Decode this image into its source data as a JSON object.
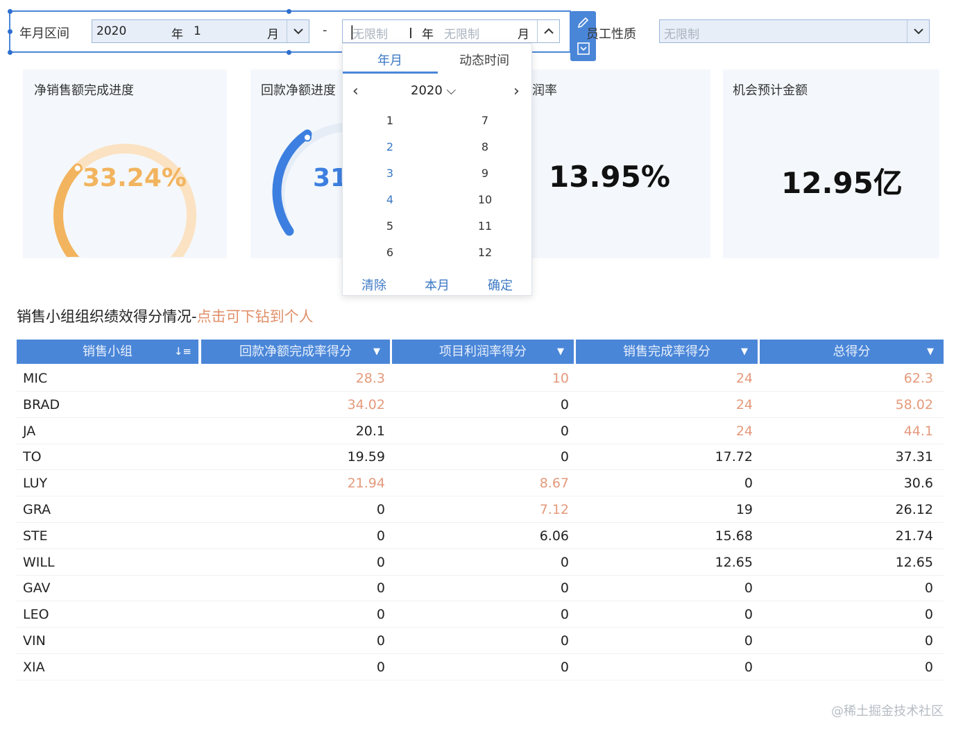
{
  "filter": {
    "range_label": "年月区间",
    "from_year": "2020",
    "year_unit": "年",
    "from_month": "1",
    "month_unit": "月",
    "separator": "-",
    "to_year_placeholder": "无限制",
    "to_month_placeholder": "无限制",
    "staff_label": "员工性质",
    "staff_placeholder": "无限制"
  },
  "kpis": {
    "sales_title": "净销售额完成进度",
    "sales_value": "33.24%",
    "sales_fraction": 0.3324,
    "refund_title": "回款净额进度",
    "refund_value_partial": "31",
    "profit_title_partial": "润率",
    "profit_value": "13.95%",
    "opportunity_title": "机会预计金额",
    "opportunity_value": "12.95亿"
  },
  "picker": {
    "tab_year_month": "年月",
    "tab_dynamic": "动态时间",
    "year": "2020",
    "months_left": [
      "1",
      "2",
      "3",
      "4",
      "5",
      "6"
    ],
    "months_right": [
      "7",
      "8",
      "9",
      "10",
      "11",
      "12"
    ],
    "btn_clear": "清除",
    "btn_this_month": "本月",
    "btn_confirm": "确定"
  },
  "table": {
    "title": "销售小组组织绩效得分情况-",
    "title_drill": "点击可下钻到个人",
    "headers": [
      "销售小组",
      "回款净额完成率得分",
      "项目利润率得分",
      "销售完成率得分",
      "总得分"
    ],
    "rows": [
      {
        "name": "MIC",
        "c1": "28.3",
        "c2": "10",
        "c3": "24",
        "c4": "62.3"
      },
      {
        "name": "BRAD",
        "c1": "34.02",
        "c2": "0",
        "c3": "24",
        "c4": "58.02"
      },
      {
        "name": "JA",
        "c1": "20.1",
        "c2": "0",
        "c3": "24",
        "c4": "44.1"
      },
      {
        "name": "TO",
        "c1": "19.59",
        "c2": "0",
        "c3": "17.72",
        "c4": "37.31"
      },
      {
        "name": "LUY",
        "c1": "21.94",
        "c2": "8.67",
        "c3": "0",
        "c4": "30.6"
      },
      {
        "name": "GRA",
        "c1": "0",
        "c2": "7.12",
        "c3": "19",
        "c4": "26.12"
      },
      {
        "name": "STE",
        "c1": "0",
        "c2": "6.06",
        "c3": "15.68",
        "c4": "21.74"
      },
      {
        "name": "WILL",
        "c1": "0",
        "c2": "0",
        "c3": "12.65",
        "c4": "12.65"
      },
      {
        "name": "GAV",
        "c1": "0",
        "c2": "0",
        "c3": "0",
        "c4": "0"
      },
      {
        "name": "LEO",
        "c1": "0",
        "c2": "0",
        "c3": "0",
        "c4": "0"
      },
      {
        "name": "VIN",
        "c1": "0",
        "c2": "0",
        "c3": "0",
        "c4": "0"
      },
      {
        "name": "XIA",
        "c1": "0",
        "c2": "0",
        "c3": "0",
        "c4": "0"
      }
    ]
  },
  "watermark": "@稀土掘金技术社区",
  "colors": {
    "accent": "#4a86d8",
    "highlight_text": "#e49a7c",
    "gauge_orange": "#f2b45e",
    "gauge_blue": "#3d7fe0"
  }
}
